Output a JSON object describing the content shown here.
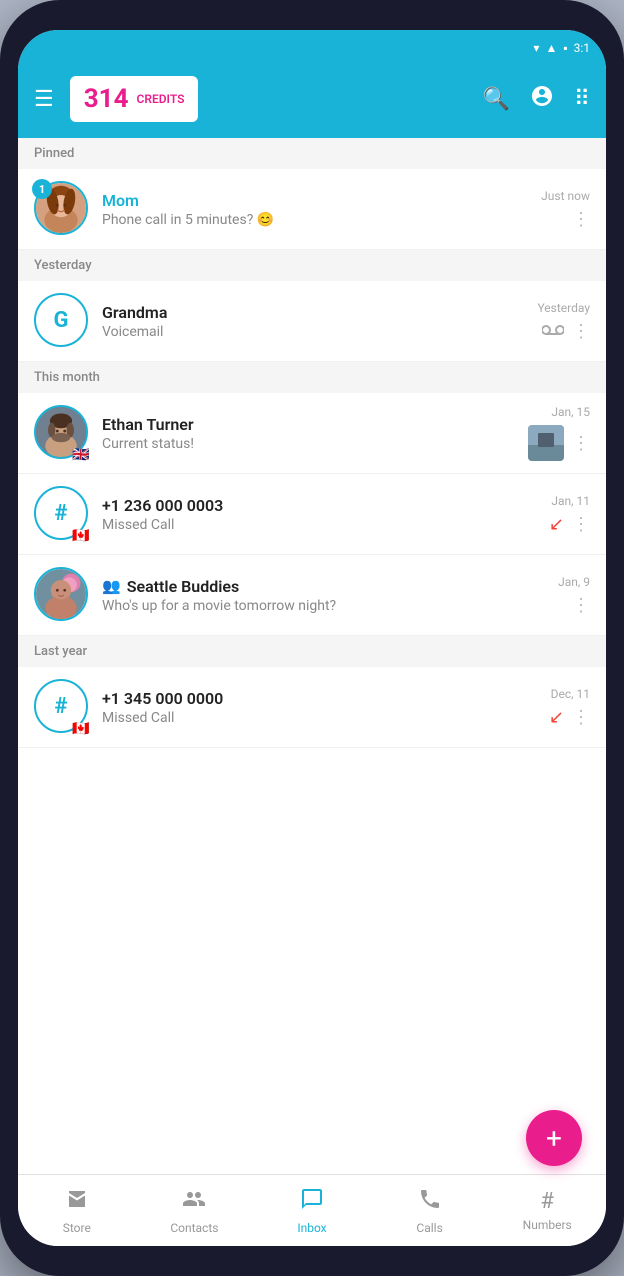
{
  "status": {
    "time": "3:1",
    "battery": "■",
    "signal": "▲"
  },
  "header": {
    "credits_number": "314",
    "credits_label": "CREDITS",
    "menu_icon": "☰",
    "search_icon": "🔍",
    "contacts_icon": "👤",
    "keypad_icon": "⠿"
  },
  "sections": [
    {
      "label": "Pinned",
      "items": [
        {
          "name": "Mom",
          "name_highlight": true,
          "preview": "Phone call in 5 minutes? 😊",
          "time": "Just now",
          "badge": "1",
          "has_avatar_photo": true,
          "avatar_type": "photo_mom"
        }
      ]
    },
    {
      "label": "Yesterday",
      "items": [
        {
          "name": "Grandma",
          "preview": "Voicemail",
          "time": "Yesterday",
          "avatar_type": "letter",
          "avatar_letter": "G",
          "has_voicemail": true
        }
      ]
    },
    {
      "label": "This month",
      "items": [
        {
          "name": "Ethan Turner",
          "preview": "Current status!",
          "time": "Jan, 15",
          "avatar_type": "photo_ethan",
          "has_flag": true,
          "flag": "🇬🇧",
          "has_thumb": true
        },
        {
          "name": "+1 236 000 0003",
          "preview": "Missed Call",
          "time": "Jan, 11",
          "avatar_type": "letter",
          "avatar_letter": "#",
          "has_flag": true,
          "flag": "🇨🇦",
          "has_missed_call": true
        },
        {
          "name": "Seattle Buddies",
          "preview": "Who's up for a movie tomorrow night?",
          "time": "Jan, 9",
          "avatar_type": "photo_seattle",
          "is_group": true
        }
      ]
    },
    {
      "label": "Last year",
      "items": [
        {
          "name": "+1 345 000 0000",
          "preview": "Missed Call",
          "time": "Dec, 11",
          "avatar_type": "letter",
          "avatar_letter": "#",
          "has_flag": true,
          "flag": "🇨🇦",
          "has_missed_call": true
        }
      ]
    }
  ],
  "fab": {
    "icon": "+"
  },
  "bottom_nav": [
    {
      "id": "store",
      "label": "Store",
      "icon": "🏪",
      "active": false
    },
    {
      "id": "contacts",
      "label": "Contacts",
      "icon": "👥",
      "active": false
    },
    {
      "id": "inbox",
      "label": "Inbox",
      "icon": "💬",
      "active": true
    },
    {
      "id": "calls",
      "label": "Calls",
      "icon": "📞",
      "active": false
    },
    {
      "id": "numbers",
      "label": "Numbers",
      "icon": "#",
      "active": false
    }
  ]
}
